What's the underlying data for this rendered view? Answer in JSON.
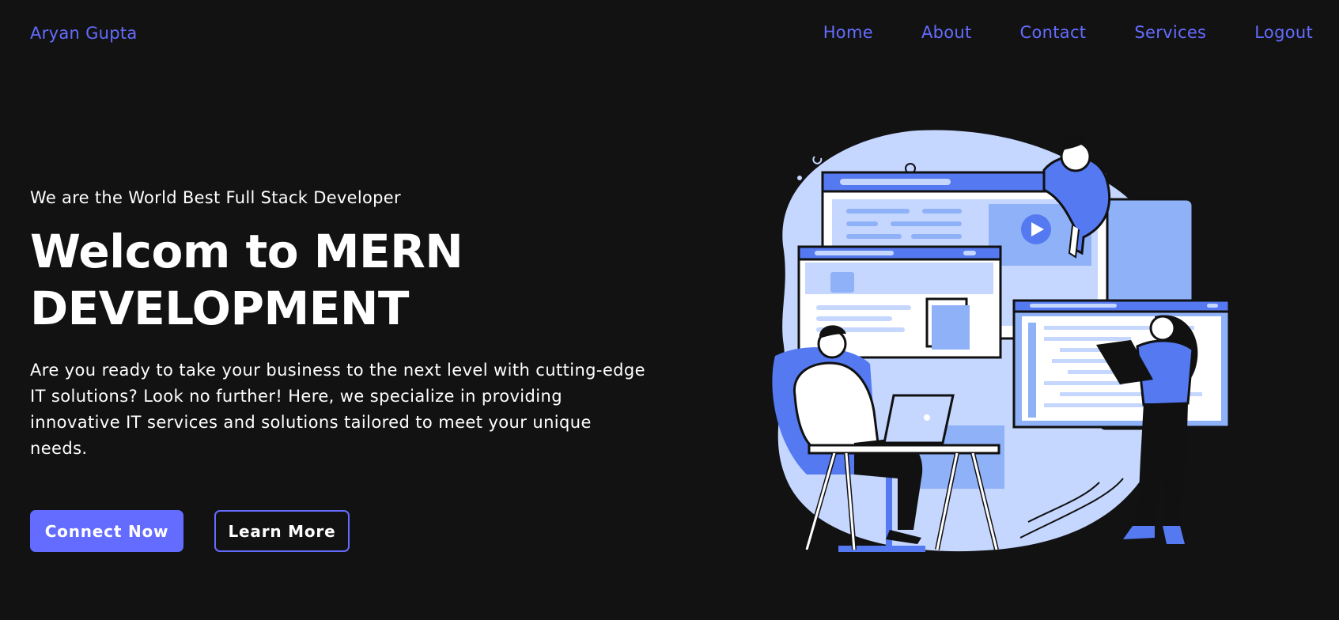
{
  "header": {
    "brand": "Aryan Gupta",
    "nav": [
      "Home",
      "About",
      "Contact",
      "Services",
      "Logout"
    ]
  },
  "hero": {
    "tagline": "We are the World Best Full Stack Developer",
    "headline_line1": "Welcom to MERN",
    "headline_line2": "DEVELOPMENT",
    "description": "Are you ready to take your business to the next level with cutting-edge IT solutions? Look no further! Here, we specialize in providing innovative IT services and solutions tailored to meet your unique needs.",
    "primary_button": "Connect Now",
    "secondary_button": "Learn More"
  },
  "colors": {
    "background": "#121212",
    "accent": "#646cff",
    "text": "#ffffff",
    "illustration_light": "#c5d6ff",
    "illustration_mid": "#8fb1f7",
    "illustration_dark": "#5479f0"
  },
  "icons": [
    "play-icon"
  ]
}
